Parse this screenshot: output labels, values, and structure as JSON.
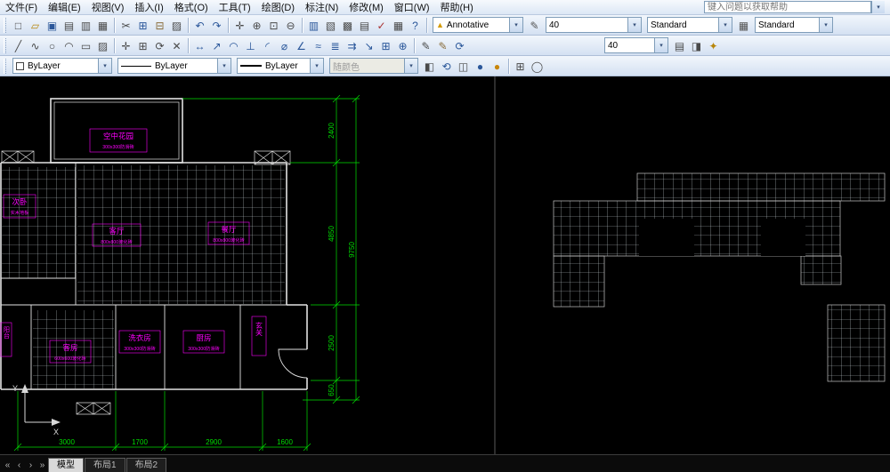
{
  "ui": {
    "dropdown": "▾"
  },
  "menubar": {
    "items": [
      {
        "id": "file",
        "label": "文件(F)"
      },
      {
        "id": "edit",
        "label": "编辑(E)"
      },
      {
        "id": "view",
        "label": "视图(V)"
      },
      {
        "id": "insert",
        "label": "插入(I)"
      },
      {
        "id": "format",
        "label": "格式(O)"
      },
      {
        "id": "tools",
        "label": "工具(T)"
      },
      {
        "id": "draw",
        "label": "绘图(D)"
      },
      {
        "id": "dimension",
        "label": "标注(N)"
      },
      {
        "id": "modify",
        "label": "修改(M)"
      },
      {
        "id": "window",
        "label": "窗口(W)"
      },
      {
        "id": "help",
        "label": "帮助(H)"
      }
    ],
    "help_placeholder": "键入问题以获取帮助"
  },
  "toolbar1": {
    "icons": [
      {
        "name": "qnew",
        "glyph": "□",
        "color": "#4a4a4a"
      },
      {
        "name": "open",
        "glyph": "▱",
        "color": "#b8860b"
      },
      {
        "name": "save",
        "glyph": "▣",
        "color": "#2b579a"
      },
      {
        "name": "plot",
        "glyph": "▤",
        "color": "#4a4a4a"
      },
      {
        "name": "plot-preview",
        "glyph": "▥",
        "color": "#4a4a4a"
      },
      {
        "name": "publish",
        "glyph": "▦",
        "color": "#4a4a4a"
      },
      {
        "sep": true
      },
      {
        "name": "cut",
        "glyph": "✂",
        "color": "#4a4a4a"
      },
      {
        "name": "copy",
        "glyph": "⊞",
        "color": "#2b579a"
      },
      {
        "name": "paste",
        "glyph": "⊟",
        "color": "#8a6d3b"
      },
      {
        "name": "match-properties",
        "glyph": "▨",
        "color": "#4a4a4a"
      },
      {
        "sep": true
      },
      {
        "name": "undo",
        "glyph": "↶",
        "color": "#2b579a"
      },
      {
        "name": "redo",
        "glyph": "↷",
        "color": "#2b579a"
      },
      {
        "sep": true
      },
      {
        "name": "pan",
        "glyph": "✛",
        "color": "#4a4a4a"
      },
      {
        "name": "zoom-realtime",
        "glyph": "⊕",
        "color": "#4a4a4a"
      },
      {
        "name": "zoom-window",
        "glyph": "⊡",
        "color": "#4a4a4a"
      },
      {
        "name": "zoom-previous",
        "glyph": "⊖",
        "color": "#4a4a4a"
      },
      {
        "sep": true
      },
      {
        "name": "properties",
        "glyph": "▥",
        "color": "#2b579a"
      },
      {
        "name": "design-center",
        "glyph": "▧",
        "color": "#4a4a4a"
      },
      {
        "name": "tool-palettes",
        "glyph": "▩",
        "color": "#4a4a4a"
      },
      {
        "name": "sheet-set-manager",
        "glyph": "▤",
        "color": "#4a4a4a"
      },
      {
        "name": "markup-set-manager",
        "glyph": "✓",
        "color": "#aa3333"
      },
      {
        "name": "quick-calc",
        "glyph": "▦",
        "color": "#4a4a4a"
      },
      {
        "name": "help",
        "glyph": "?",
        "color": "#2b579a"
      },
      {
        "sep": true
      }
    ],
    "annotative_glyph": "▲",
    "annotative_label": "Annotative",
    "icons_b": [
      {
        "name": "text-style",
        "glyph": "✎",
        "color": "#555555"
      }
    ],
    "text_height": "40",
    "style1": "Standard",
    "icons_c": [
      {
        "name": "table-style",
        "glyph": "▦",
        "color": "#555555"
      }
    ],
    "style2": "Standard"
  },
  "toolbar2": {
    "icons": [
      {
        "name": "line",
        "glyph": "╱",
        "color": "#4a4a4a"
      },
      {
        "name": "polyline",
        "glyph": "∿",
        "color": "#4a4a4a"
      },
      {
        "name": "circle",
        "glyph": "○",
        "color": "#4a4a4a"
      },
      {
        "name": "arc",
        "glyph": "◠",
        "color": "#4a4a4a"
      },
      {
        "name": "rectangle",
        "glyph": "▭",
        "color": "#4a4a4a"
      },
      {
        "name": "hatch",
        "glyph": "▨",
        "color": "#4a4a4a"
      },
      {
        "sep": true
      },
      {
        "name": "move",
        "glyph": "✛",
        "color": "#4a4a4a"
      },
      {
        "name": "copy-object",
        "glyph": "⊞",
        "color": "#4a4a4a"
      },
      {
        "name": "rotate",
        "glyph": "⟳",
        "color": "#4a4a4a"
      },
      {
        "name": "erase",
        "glyph": "✕",
        "color": "#4a4a4a"
      },
      {
        "sep": true
      },
      {
        "name": "dim-linear",
        "glyph": "↔",
        "color": "#2b579a"
      },
      {
        "name": "dim-aligned",
        "glyph": "↗",
        "color": "#2b579a"
      },
      {
        "name": "dim-arc-length",
        "glyph": "◠",
        "color": "#2b579a"
      },
      {
        "name": "dim-ordinate",
        "glyph": "⊥",
        "color": "#2b579a"
      },
      {
        "name": "dim-radius",
        "glyph": "◜",
        "color": "#2b579a"
      },
      {
        "name": "dim-diameter",
        "glyph": "⌀",
        "color": "#2b579a"
      },
      {
        "name": "dim-angular",
        "glyph": "∠",
        "color": "#2b579a"
      },
      {
        "name": "quick-dim",
        "glyph": "≈",
        "color": "#2b579a"
      },
      {
        "name": "dim-baseline",
        "glyph": "≣",
        "color": "#2b579a"
      },
      {
        "name": "dim-continue",
        "glyph": "⇉",
        "color": "#2b579a"
      },
      {
        "name": "multileader",
        "glyph": "↘",
        "color": "#2b579a"
      },
      {
        "name": "tolerance",
        "glyph": "⊞",
        "color": "#2b579a"
      },
      {
        "name": "center-mark",
        "glyph": "⊕",
        "color": "#2b579a"
      },
      {
        "sep": true
      },
      {
        "name": "dim-edit",
        "glyph": "✎",
        "color": "#4a4a4a"
      },
      {
        "name": "dim-text-edit",
        "glyph": "✎",
        "color": "#8a6d3b"
      },
      {
        "name": "dim-update",
        "glyph": "⟳",
        "color": "#2b579a"
      }
    ],
    "dim_style": "40",
    "icons_right": [
      {
        "name": "dim-style-manager",
        "glyph": "▤",
        "color": "#4a4a4a"
      },
      {
        "name": "annotation-reset",
        "glyph": "◨",
        "color": "#4a4a4a"
      },
      {
        "name": "annotation-sync",
        "glyph": "✦",
        "color": "#b8860b"
      }
    ]
  },
  "toolbar3": {
    "color_value": "ByLayer",
    "linetype_value": "ByLayer",
    "lineweight_value": "ByLayer",
    "plotstyle_value": "随颜色",
    "icons": [
      {
        "name": "make-object-layer-current",
        "glyph": "◧",
        "color": "#4a4a4a"
      },
      {
        "name": "layer-previous",
        "glyph": "⟲",
        "color": "#2b579a"
      },
      {
        "name": "hide-3d",
        "glyph": "◫",
        "color": "#4a4a4a"
      },
      {
        "name": "render-sphere-blue",
        "glyph": "●",
        "color": "#2b579a"
      },
      {
        "name": "render-sphere-gold",
        "glyph": "●",
        "color": "#c8860b"
      },
      {
        "sep": true
      },
      {
        "name": "named-views",
        "glyph": "⊞",
        "color": "#4a4a4a"
      },
      {
        "name": "orbit-3d",
        "glyph": "◯",
        "color": "#4a4a4a"
      }
    ]
  },
  "statusbar": {
    "nav": [
      {
        "name": "first-tab",
        "glyph": "«",
        "color": "#b5b5b5"
      },
      {
        "name": "prev-tab",
        "glyph": "‹",
        "color": "#b5b5b5"
      },
      {
        "name": "next-tab",
        "glyph": "›",
        "color": "#b5b5b5"
      },
      {
        "name": "last-tab",
        "glyph": "»",
        "color": "#b5b5b5"
      }
    ],
    "tabs": [
      {
        "id": "model",
        "label": "模型",
        "active": true
      },
      {
        "id": "layout1",
        "label": "布局1",
        "active": false
      },
      {
        "id": "layout2",
        "label": "布局2",
        "active": false
      }
    ]
  },
  "drawing": {
    "rooms": [
      {
        "name": "空中花园",
        "sub": "300x300防滑砖"
      },
      {
        "name": "次卧",
        "sub": "实木地板"
      },
      {
        "name": "客厅",
        "sub": "800x800玻化砖"
      },
      {
        "name": "餐厅",
        "sub": "800x800玻化砖"
      },
      {
        "name": "客房",
        "sub": "600x600玻化砖"
      },
      {
        "name": "洗衣房",
        "sub": "300x300防滑砖"
      },
      {
        "name": "厨房",
        "sub": "300x300防滑砖"
      },
      {
        "name": "玄关",
        "sub": ""
      },
      {
        "name": "阳台",
        "sub": ""
      }
    ],
    "dims": {
      "right": [
        "2400",
        "4850",
        "2500",
        "650"
      ],
      "right_total": "9750",
      "bottom": [
        "3000",
        "1700",
        "2900",
        "1600"
      ]
    },
    "ucs": {
      "x_label": "X",
      "y_label": "Y"
    }
  }
}
